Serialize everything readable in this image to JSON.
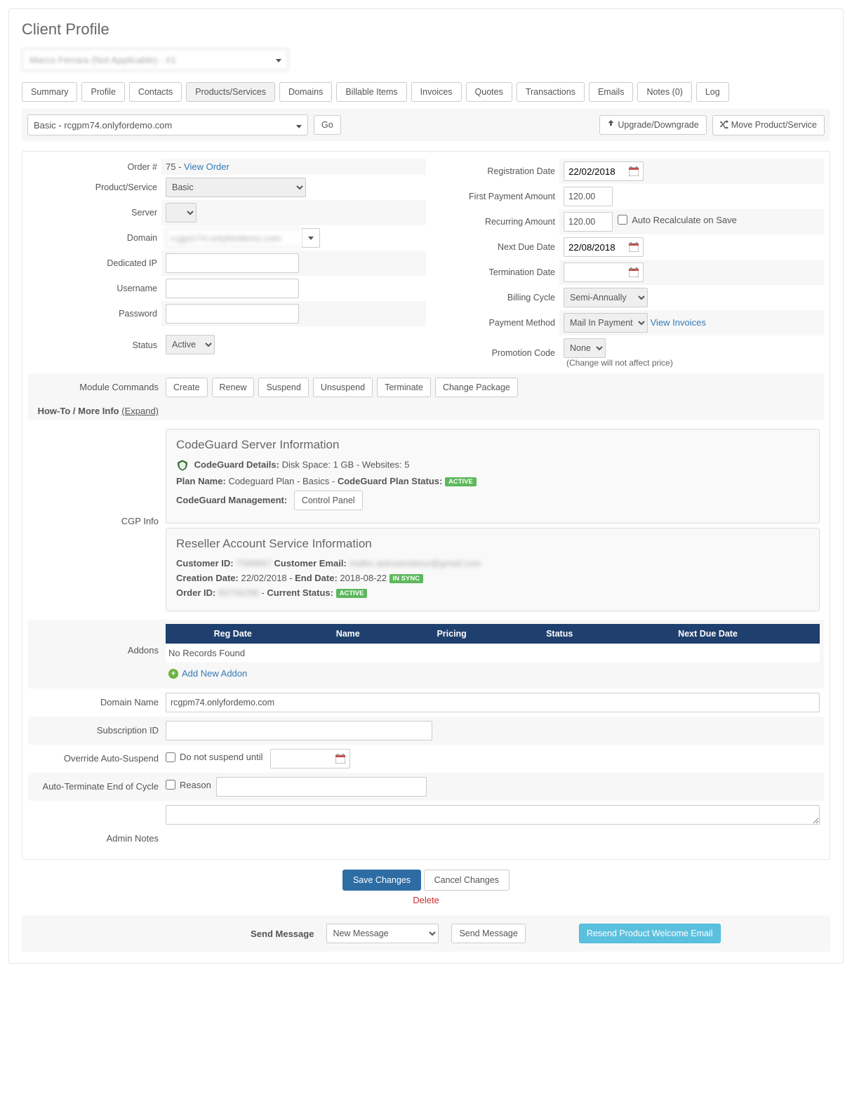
{
  "page_title": "Client Profile",
  "client_selected": "Marco Ferrara (Not Applicable) - #1",
  "tabs": [
    "Summary",
    "Profile",
    "Contacts",
    "Products/Services",
    "Domains",
    "Billable Items",
    "Invoices",
    "Quotes",
    "Transactions",
    "Emails",
    "Notes (0)",
    "Log"
  ],
  "active_tab_index": 3,
  "toolbar": {
    "product_select": "Basic - rcgpm74.onlyfordemo.com",
    "go": "Go",
    "upgrade": "Upgrade/Downgrade",
    "move": "Move Product/Service"
  },
  "left": {
    "order_label": "Order #",
    "order_num": "75",
    "order_link": "View Order",
    "product_service_label": "Product/Service",
    "product_service": "Basic",
    "server_label": "Server",
    "server": "",
    "domain_label": "Domain",
    "domain": "rcgpm74.onlyfordemo.com",
    "dedicated_ip_label": "Dedicated IP",
    "dedicated_ip": "",
    "username_label": "Username",
    "username": "",
    "password_label": "Password",
    "password": "",
    "status_label": "Status",
    "status": "Active"
  },
  "right": {
    "reg_date_label": "Registration Date",
    "reg_date": "22/02/2018",
    "first_payment_label": "First Payment Amount",
    "first_payment": "120.00",
    "recurring_label": "Recurring Amount",
    "recurring": "120.00",
    "auto_recalc_label": "Auto Recalculate on Save",
    "next_due_label": "Next Due Date",
    "next_due": "22/08/2018",
    "termination_label": "Termination Date",
    "termination": "",
    "billing_cycle_label": "Billing Cycle",
    "billing_cycle": "Semi-Annually",
    "payment_method_label": "Payment Method",
    "payment_method": "Mail In Payment",
    "view_invoices": "View Invoices",
    "promo_label": "Promotion Code",
    "promo": "None",
    "promo_note": "(Change will not affect price)"
  },
  "module": {
    "label": "Module Commands",
    "buttons": [
      "Create",
      "Renew",
      "Suspend",
      "Unsuspend",
      "Terminate",
      "Change Package"
    ],
    "howto": "How-To / More Info",
    "expand": "(Expand)"
  },
  "cgp": {
    "label": "CGP Info",
    "codeguard": {
      "heading": "CodeGuard Server Information",
      "details_label": "CodeGuard Details:",
      "details": "Disk Space: 1 GB - Websites: 5",
      "plan_name_label": "Plan Name:",
      "plan_name": "Codeguard Plan - Basics",
      "plan_status_label": "CodeGuard Plan Status:",
      "plan_status_badge": "ACTIVE",
      "mgmt_label": "CodeGuard Management:",
      "control_panel": "Control Panel"
    },
    "reseller": {
      "heading": "Reseller Account Service Information",
      "customer_id_label": "Customer ID:",
      "customer_id": "7589667",
      "customer_email_label": "Customer Email:",
      "customer_email": "mafec.astroamateur@gmail.com",
      "creation_label": "Creation Date:",
      "creation": "22/02/2018",
      "end_label": "End Date:",
      "end": "2018-08-22",
      "sync_badge": "IN SYNC",
      "order_id_label": "Order ID:",
      "order_id": "80706296",
      "current_status_label": "Current Status:",
      "current_status_badge": "ACTIVE"
    }
  },
  "addons": {
    "label": "Addons",
    "headers": [
      "Reg Date",
      "Name",
      "Pricing",
      "Status",
      "Next Due Date",
      ""
    ],
    "empty": "No Records Found",
    "add_new": "Add New Addon"
  },
  "lower": {
    "domain_name_label": "Domain Name",
    "domain_name": "rcgpm74.onlyfordemo.com",
    "subscription_label": "Subscription ID",
    "subscription": "",
    "override_label": "Override Auto-Suspend",
    "override_check": "Do not suspend until",
    "autoterm_label": "Auto-Terminate End of Cycle",
    "autoterm_check": "Reason",
    "admin_notes_label": "Admin Notes"
  },
  "actions": {
    "save": "Save Changes",
    "cancel": "Cancel Changes",
    "delete": "Delete"
  },
  "send": {
    "label": "Send Message",
    "select": "New Message",
    "btn": "Send Message",
    "resend": "Resend Product Welcome Email"
  }
}
